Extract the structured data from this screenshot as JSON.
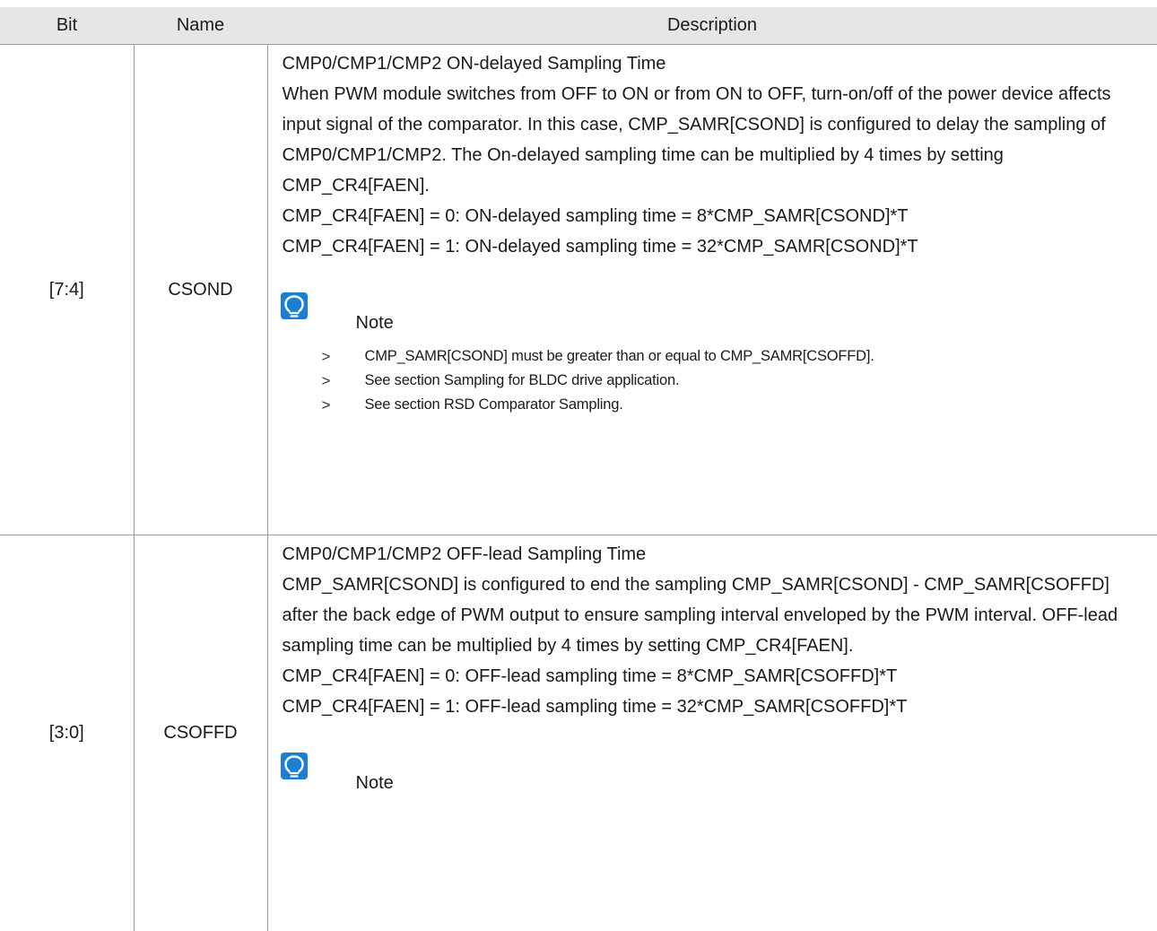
{
  "table": {
    "headers": {
      "bit": "Bit",
      "name": "Name",
      "description": "Description"
    },
    "rows": [
      {
        "bit": "[7:4]",
        "name": "CSOND",
        "title": "CMP0/CMP1/CMP2 ON-delayed Sampling Time",
        "body": "When PWM module switches from OFF to ON or from ON to OFF, turn-on/off of the power device affects input signal of the comparator. In this case, CMP_SAMR[CSOND] is configured to delay the sampling of CMP0/CMP1/CMP2. The On-delayed sampling time can be multiplied by 4 times by setting CMP_CR4[FAEN].",
        "eq0": "CMP_CR4[FAEN] = 0: ON-delayed sampling time = 8*CMP_SAMR[CSOND]*T",
        "eq1": "CMP_CR4[FAEN] = 1: ON-delayed sampling time = 32*CMP_SAMR[CSOND]*T",
        "note_label": "Note",
        "note_icon": "lightbulb-icon",
        "notes": [
          "CMP_SAMR[CSOND] must be greater than or equal to CMP_SAMR[CSOFFD].",
          "See section Sampling for BLDC drive application.",
          "See section RSD Comparator Sampling."
        ]
      },
      {
        "bit": "[3:0]",
        "name": "CSOFFD",
        "title": "CMP0/CMP1/CMP2 OFF-lead Sampling Time",
        "body": "CMP_SAMR[CSOND] is configured to end the sampling CMP_SAMR[CSOND] - CMP_SAMR[CSOFFD] after the back edge of PWM output to ensure sampling interval enveloped by the PWM interval. OFF-lead sampling time can be multiplied by 4 times by setting CMP_CR4[FAEN].",
        "eq0": "CMP_CR4[FAEN] = 0: OFF-lead sampling time = 8*CMP_SAMR[CSOFFD]*T",
        "eq1": "CMP_CR4[FAEN] = 1: OFF-lead sampling time = 32*CMP_SAMR[CSOFFD]*T",
        "note_label": "Note",
        "note_icon": "lightbulb-icon"
      }
    ]
  },
  "colors": {
    "header_bg": "#e6e6e6",
    "rule": "#9a9a9a",
    "note_icon_bg": "#1a7ed1"
  }
}
